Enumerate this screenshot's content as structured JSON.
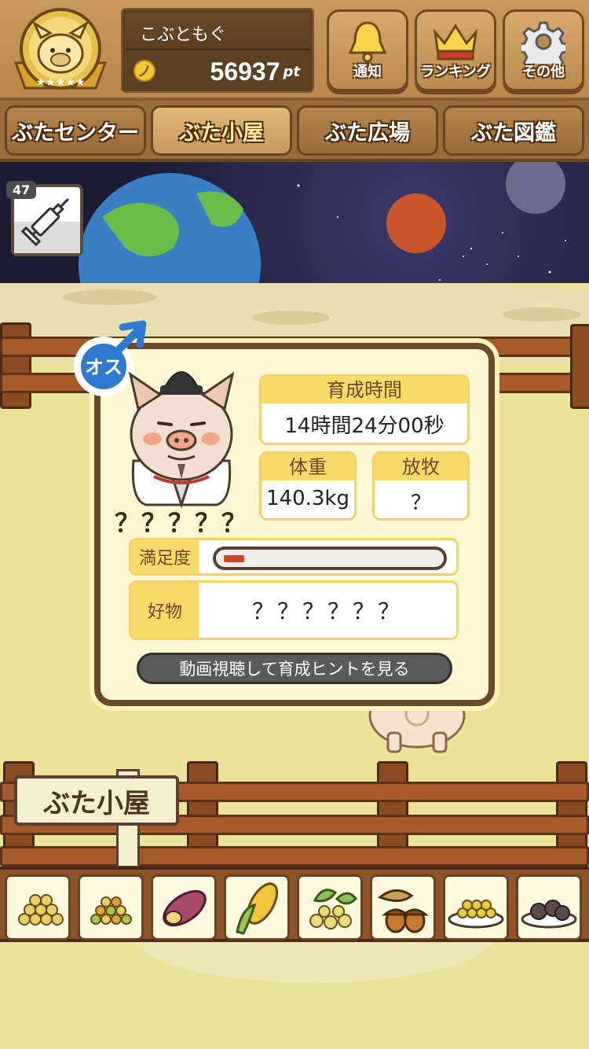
{
  "header": {
    "username": "こぶともぐ",
    "points": "56937",
    "points_unit": "pt",
    "coin_symbol": "ノ",
    "buttons": [
      {
        "label": "通知",
        "icon": "bell-icon"
      },
      {
        "label": "ランキング",
        "icon": "crown-icon"
      },
      {
        "label": "その他",
        "icon": "gear-icon"
      }
    ]
  },
  "tabs": [
    {
      "label": "ぶたセンター",
      "active": false
    },
    {
      "label": "ぶた小屋",
      "active": true
    },
    {
      "label": "ぶた広場",
      "active": false
    },
    {
      "label": "ぶた図鑑",
      "active": false
    }
  ],
  "item": {
    "count": "47",
    "icon": "syringe-icon"
  },
  "pig": {
    "gender_label": "オス",
    "gender_icon": "male-icon",
    "name": "？？？？？"
  },
  "stats": {
    "raising_time_label": "育成時間",
    "raising_time_value": "14時間24分00秒",
    "weight_label": "体重",
    "weight_value": "140.3kg",
    "grazing_label": "放牧",
    "grazing_value": "？",
    "satisfaction_label": "満足度",
    "satisfaction_level": 0.08,
    "favorite_label": "好物",
    "favorite_value": "？？？？？？"
  },
  "hint_button": "動画視聴して育成ヒントを見る",
  "sign": "ぶた小屋",
  "colors": {
    "accent_yellow": "#f7da6a",
    "wood": "#8e5428",
    "satisfaction_fill": "#d0442c"
  },
  "food_items": [
    {
      "name": "grain-pile-icon"
    },
    {
      "name": "mixed-grain-icon"
    },
    {
      "name": "sweet-potato-icon"
    },
    {
      "name": "corn-icon"
    },
    {
      "name": "soybean-icon"
    },
    {
      "name": "acorn-icon"
    },
    {
      "name": "bean-plate-icon"
    },
    {
      "name": "rice-ball-plate-icon"
    }
  ]
}
